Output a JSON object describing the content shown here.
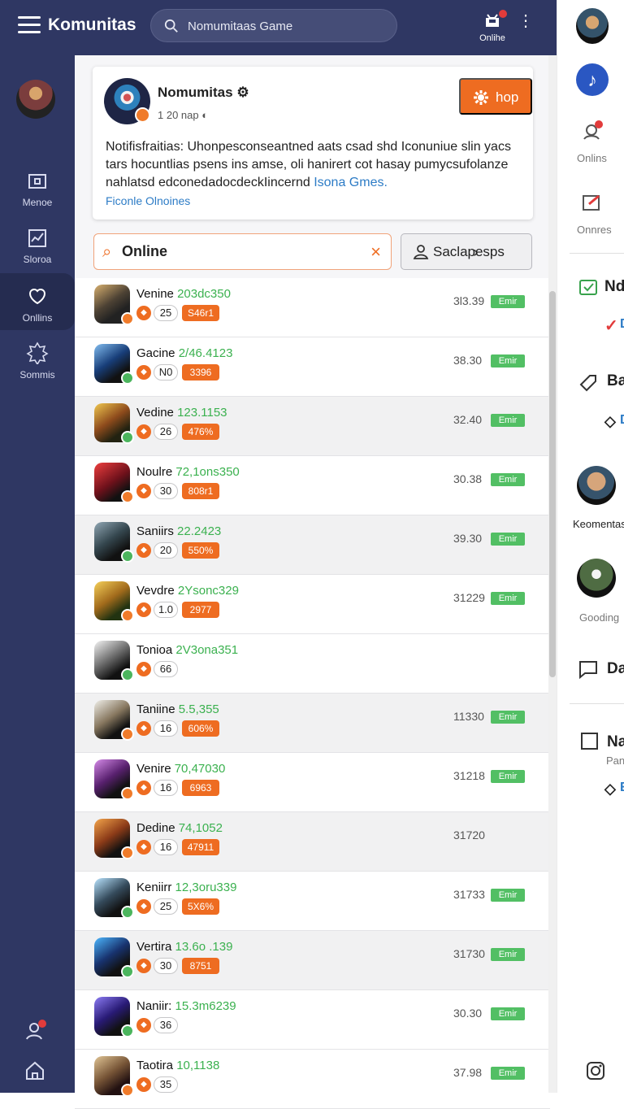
{
  "app": {
    "title": "Komunitas",
    "search_placeholder": "Nomumitaas Game",
    "top_online": "Onlihe"
  },
  "sidebar": {
    "items": [
      {
        "label": "Menoe"
      },
      {
        "label": "Sloroa"
      },
      {
        "label": "Onllins"
      },
      {
        "label": "Sommis"
      }
    ]
  },
  "card": {
    "title": "Nomumitas",
    "subtitle": "1 20 nap",
    "description": "Notifisfraitias: Uhonpesconseantned aats csad shd Iconuniue slin yacs tars hocuntlias psens ins amse, oli hanirert cot hasay pumycsufolanze nahlatsd edconedadocdeckIincernd",
    "description_link_text": "Isona Gmes.",
    "link": "Ficonle Olnoines",
    "hop_label": "hop"
  },
  "filter": {
    "value": "Online",
    "save_label": "Saclapesps"
  },
  "rows": [
    {
      "name": "Venine",
      "code": "203dc350",
      "count": "25",
      "tag": "S46r1",
      "value": "3l3.39",
      "status": "Emir"
    },
    {
      "name": "Gacine",
      "code": "2/46.4123",
      "count": "N0",
      "tag": "3396",
      "value": "38.30",
      "status": "Emir"
    },
    {
      "name": "Vedine",
      "code": "123.1153",
      "count": "26",
      "tag": "476%",
      "value": "32.40",
      "status": "Emir"
    },
    {
      "name": "Noulre",
      "code": "72,1ons350",
      "count": "30",
      "tag": "808r1",
      "value": "30.38",
      "status": "Emir"
    },
    {
      "name": "Saniirs",
      "code": "22.2423",
      "count": "20",
      "tag": "550%",
      "value": "39.30",
      "status": "Emir"
    },
    {
      "name": "Vevdre",
      "code": "2Ysonc329",
      "count": "1.0",
      "tag": "2977",
      "value": "31229",
      "status": "Emir"
    },
    {
      "name": "Tonioa",
      "code": "2V3ona351",
      "count": "66",
      "tag": "",
      "value": "",
      "status": ""
    },
    {
      "name": "Taniine",
      "code": "5.5,355",
      "count": "16",
      "tag": "606%",
      "value": "11330",
      "status": "Emir"
    },
    {
      "name": "Venire",
      "code": "70,47030",
      "count": "16",
      "tag": "6963",
      "value": "31218",
      "status": "Emir"
    },
    {
      "name": "Dedine",
      "code": "74,1052",
      "count": "16",
      "tag": "47911",
      "value": "31720",
      "status": ""
    },
    {
      "name": "Keniirr",
      "code": "12,3oru339",
      "count": "25",
      "tag": "5X6%",
      "value": "31733",
      "status": "Emir"
    },
    {
      "name": "Vertira",
      "code": "13.6o .139",
      "count": "30",
      "tag": "8751",
      "value": "31730",
      "status": "Emir"
    },
    {
      "name": "Naniir:",
      "code": "15.3m6239",
      "count": "36",
      "tag": "",
      "value": "30.30",
      "status": "Emir"
    },
    {
      "name": "Taotira",
      "code": "10,1138",
      "count": "35",
      "tag": "",
      "value": "37.98",
      "status": "Emir"
    }
  ],
  "right": {
    "labels": [
      "Onlins",
      "Onnres",
      "Keomentas",
      "Gooding"
    ],
    "headings": [
      "Nd",
      "Ba",
      "Da",
      "Na"
    ],
    "small_text": "Pan",
    "markers": [
      "D",
      "D",
      "E"
    ]
  }
}
